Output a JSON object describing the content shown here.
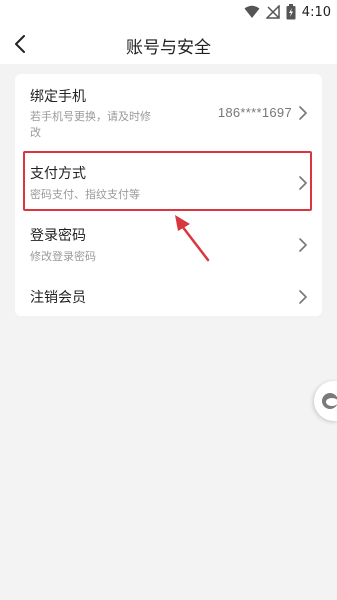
{
  "status_bar": {
    "time": "4:10",
    "icons": [
      "wifi-icon",
      "signal-off-icon",
      "battery-charging-icon"
    ]
  },
  "header": {
    "title": "账号与安全",
    "back_icon": "chevron-left-icon"
  },
  "settings": {
    "items": [
      {
        "title": "绑定手机",
        "subtitle_line1": "若手机号更换，请及时修",
        "subtitle_line2": "改",
        "value": "186****1697"
      },
      {
        "title": "支付方式",
        "subtitle": "密码支付、指纹支付等"
      },
      {
        "title": "登录密码",
        "subtitle": "修改登录密码"
      },
      {
        "title": "注销会员"
      }
    ]
  },
  "annotation": {
    "highlight_color": "#d9363e"
  },
  "colors": {
    "background": "#f3f3f3",
    "card": "#ffffff",
    "subtitle": "#9a9a9a"
  }
}
